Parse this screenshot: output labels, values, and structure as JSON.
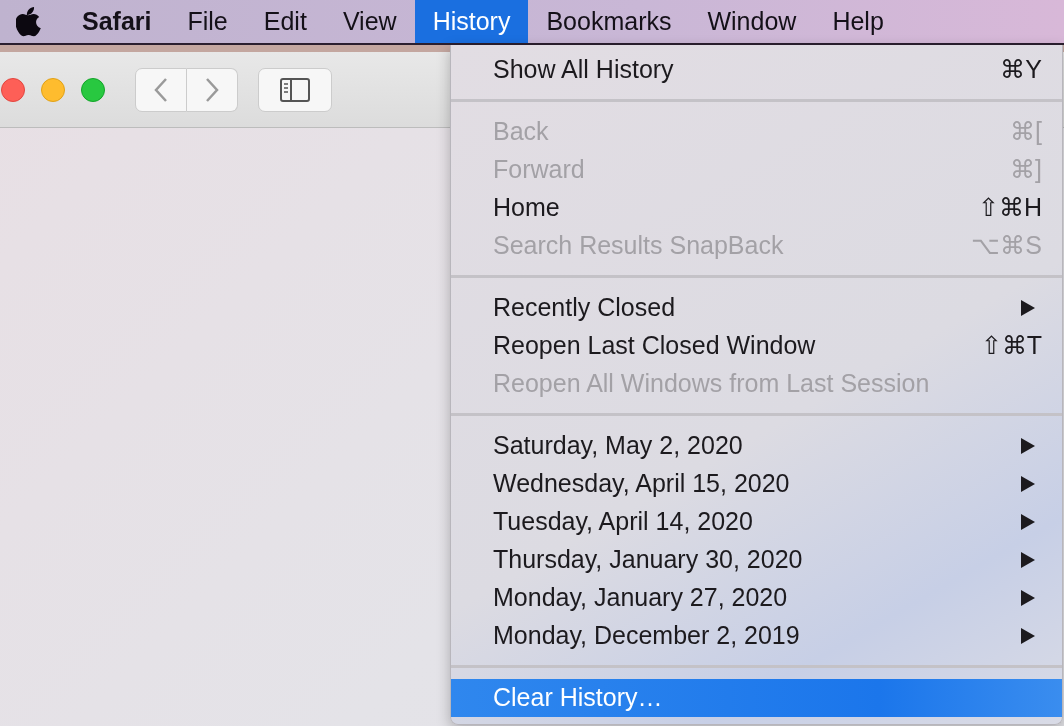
{
  "menu_bar": {
    "app_name": "Safari",
    "menus": [
      {
        "label": "File",
        "selected": false
      },
      {
        "label": "Edit",
        "selected": false
      },
      {
        "label": "View",
        "selected": false
      },
      {
        "label": "History",
        "selected": true
      },
      {
        "label": "Bookmarks",
        "selected": false
      },
      {
        "label": "Window",
        "selected": false
      },
      {
        "label": "Help",
        "selected": false
      }
    ]
  },
  "history_menu": {
    "entries": [
      {
        "kind": "item",
        "label": "Show All History",
        "shortcut": "⌘Y",
        "disabled": false,
        "submenu": false,
        "selected": false
      },
      {
        "kind": "separator"
      },
      {
        "kind": "item",
        "label": "Back",
        "shortcut": "⌘[",
        "disabled": true,
        "submenu": false,
        "selected": false
      },
      {
        "kind": "item",
        "label": "Forward",
        "shortcut": "⌘]",
        "disabled": true,
        "submenu": false,
        "selected": false
      },
      {
        "kind": "item",
        "label": "Home",
        "shortcut": "⇧⌘H",
        "disabled": false,
        "submenu": false,
        "selected": false
      },
      {
        "kind": "item",
        "label": "Search Results SnapBack",
        "shortcut": "⌥⌘S",
        "disabled": true,
        "submenu": false,
        "selected": false
      },
      {
        "kind": "separator"
      },
      {
        "kind": "item",
        "label": "Recently Closed",
        "disabled": false,
        "submenu": true,
        "selected": false
      },
      {
        "kind": "item",
        "label": "Reopen Last Closed Window",
        "shortcut": "⇧⌘T",
        "disabled": false,
        "submenu": false,
        "selected": false
      },
      {
        "kind": "item",
        "label": "Reopen All Windows from Last Session",
        "disabled": true,
        "submenu": false,
        "selected": false
      },
      {
        "kind": "separator"
      },
      {
        "kind": "item",
        "label": "Saturday, May 2, 2020",
        "disabled": false,
        "submenu": true,
        "selected": false
      },
      {
        "kind": "item",
        "label": "Wednesday, April 15, 2020",
        "disabled": false,
        "submenu": true,
        "selected": false
      },
      {
        "kind": "item",
        "label": "Tuesday, April 14, 2020",
        "disabled": false,
        "submenu": true,
        "selected": false
      },
      {
        "kind": "item",
        "label": "Thursday, January 30, 2020",
        "disabled": false,
        "submenu": true,
        "selected": false
      },
      {
        "kind": "item",
        "label": "Monday, January 27, 2020",
        "disabled": false,
        "submenu": true,
        "selected": false
      },
      {
        "kind": "item",
        "label": "Monday, December 2, 2019",
        "disabled": false,
        "submenu": true,
        "selected": false
      },
      {
        "kind": "separator"
      },
      {
        "kind": "item",
        "label": "Clear History…",
        "disabled": false,
        "submenu": false,
        "selected": true
      }
    ]
  }
}
